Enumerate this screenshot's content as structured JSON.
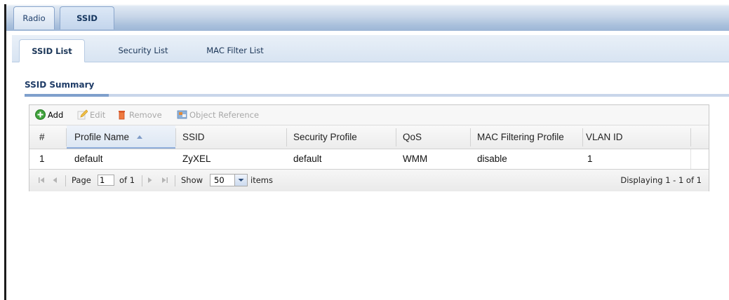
{
  "tabs": [
    {
      "label": "Radio",
      "active": false
    },
    {
      "label": "SSID",
      "active": true
    }
  ],
  "subtabs": [
    {
      "label": "SSID List",
      "active": true
    },
    {
      "label": "Security List",
      "active": false
    },
    {
      "label": "MAC Filter List",
      "active": false
    }
  ],
  "section": {
    "title": "SSID Summary"
  },
  "toolbar": {
    "add_label": "Add",
    "edit_label": "Edit",
    "remove_label": "Remove",
    "object_reference_label": "Object Reference"
  },
  "table": {
    "headers": {
      "index": "#",
      "profile_name": "Profile Name",
      "ssid": "SSID",
      "security_profile": "Security Profile",
      "qos": "QoS",
      "mac_filtering_profile": "MAC Filtering Profile",
      "vlan_id": "VLAN ID"
    },
    "sorted_column": "profile_name",
    "rows": [
      {
        "index": "1",
        "profile_name": "default",
        "ssid": "ZyXEL",
        "security_profile": "default",
        "qos": "WMM",
        "mac_filtering_profile": "disable",
        "vlan_id": "1"
      }
    ]
  },
  "pager": {
    "page_label": "Page",
    "page_value": "1",
    "of_label": "of 1",
    "show_label": "Show",
    "page_size": "50",
    "items_label": "items",
    "displaying": "Displaying 1 - 1 of 1"
  },
  "colors": {
    "accent": "#7fa0cc",
    "tab_text": "#1f3f6a",
    "add_icon": "#3fa23b",
    "remove_icon": "#e05a2a"
  }
}
